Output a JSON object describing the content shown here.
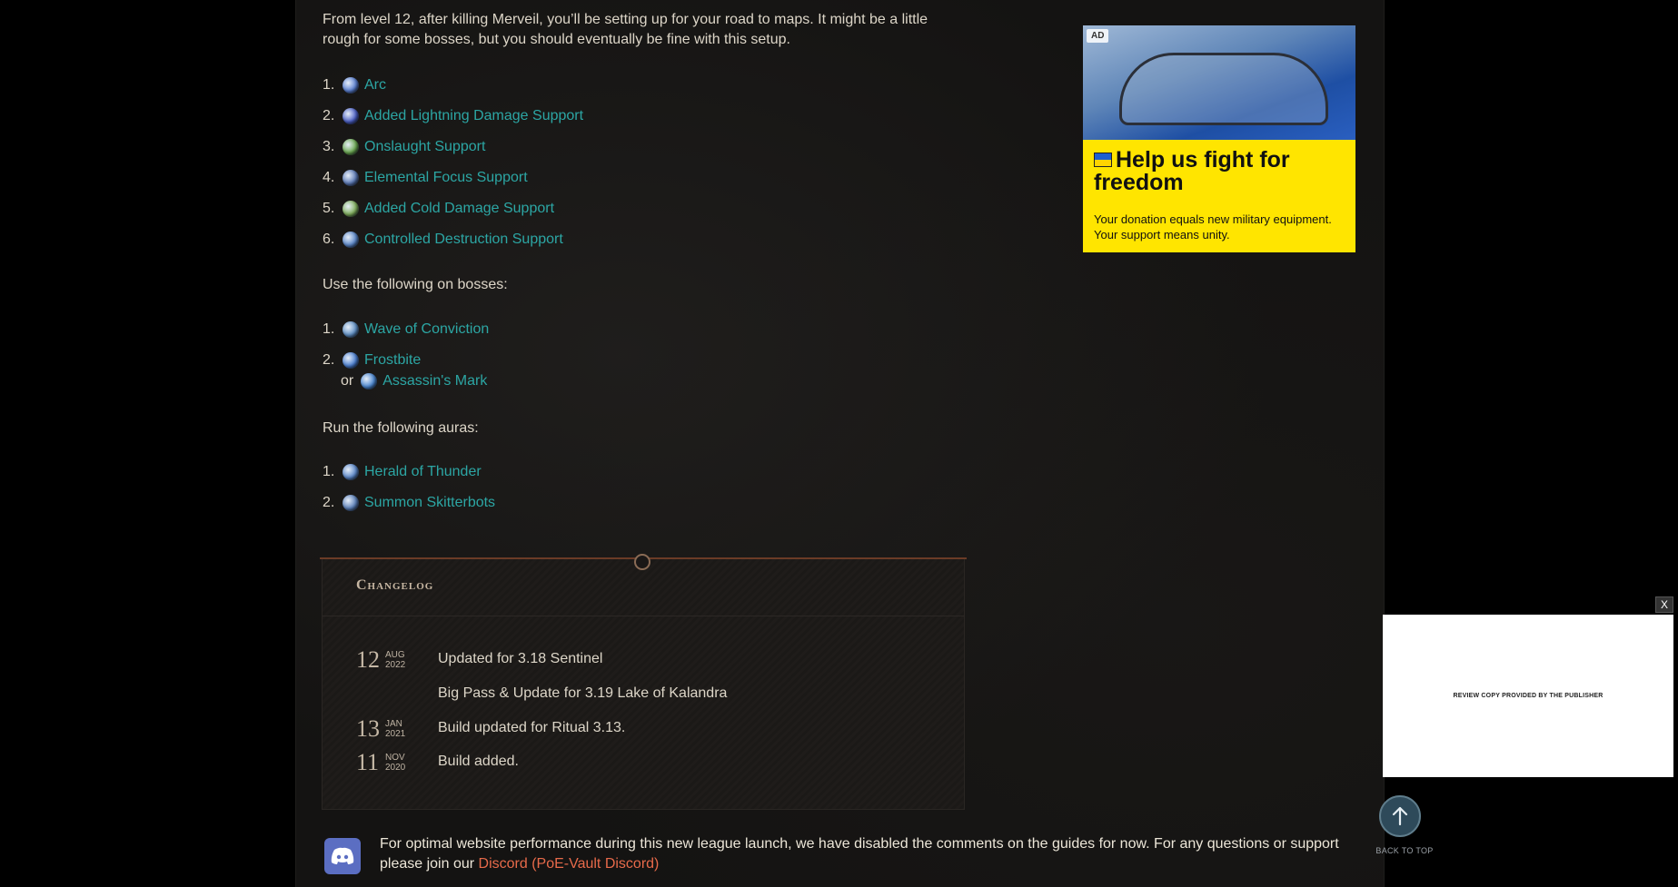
{
  "intro_text": "From level 12, after killing Merveil, you’ll be setting up for your road to maps. It might be a little rough for some bosses, but you should eventually be fine with this setup.",
  "main_gems": [
    {
      "num": "1.",
      "label": "Arc",
      "color": "#5a7fd0"
    },
    {
      "num": "2.",
      "label": "Added Lightning Damage Support",
      "color": "#4b5fc4"
    },
    {
      "num": "3.",
      "label": "Onslaught Support",
      "color": "#6aa84f"
    },
    {
      "num": "4.",
      "label": "Elemental Focus Support",
      "color": "#5b79b5"
    },
    {
      "num": "5.",
      "label": "Added Cold Damage Support",
      "color": "#7fae5a"
    },
    {
      "num": "6.",
      "label": "Controlled Destruction Support",
      "color": "#5a86c8"
    }
  ],
  "bosses_heading": "Use the following on bosses:",
  "boss_gems": [
    {
      "num": "1.",
      "label": "Wave of Conviction",
      "color": "#5f8fc4"
    },
    {
      "num": "2.",
      "label": "Frostbite",
      "color": "#4a7ed0"
    }
  ],
  "boss_alt": {
    "or": "or",
    "label": "Assassin's Mark",
    "color": "#4a86d0"
  },
  "auras_heading": "Run the following auras:",
  "aura_gems": [
    {
      "num": "1.",
      "label": "Herald of Thunder",
      "color": "#5a86c8"
    },
    {
      "num": "2.",
      "label": "Summon Skitterbots",
      "color": "#5a7fb8"
    }
  ],
  "changelog": {
    "title": "Changelog",
    "entries": [
      {
        "day": "12",
        "month": "AUG",
        "year": "2022",
        "text": "Updated for 3.18 Sentinel"
      },
      {
        "text": "Big Pass & Update for 3.19 Lake of Kalandra"
      },
      {
        "day": "13",
        "month": "JAN",
        "year": "2021",
        "text": "Build updated for Ritual 3.13."
      },
      {
        "day": "11",
        "month": "NOV",
        "year": "2020",
        "text": "Build added."
      }
    ]
  },
  "notice": {
    "text": "For optimal website performance during this new league launch, we have disabled the comments on the guides for now. For any questions or support please join our ",
    "link": "Discord (PoE-Vault Discord)"
  },
  "ad": {
    "badge": "AD",
    "headline": "Help us fight for freedom",
    "body": "Your donation equals new military equipment. Your support means unity.",
    "flag_top": "#1d5fd1",
    "flag_bottom": "#ffd400"
  },
  "float_ad": {
    "text": "REVIEW COPY PROVIDED BY THE PUBLISHER",
    "close": "X"
  },
  "back_to_top": {
    "label": "BACK TO TOP"
  },
  "accent_link_color": "#2ca6a4"
}
